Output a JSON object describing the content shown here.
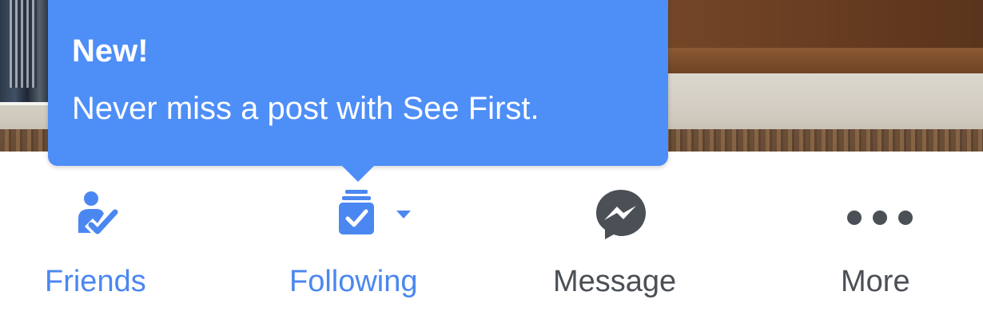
{
  "tooltip": {
    "title": "New!",
    "message": "Never miss a post with See First."
  },
  "actions": [
    {
      "label": "Friends",
      "icon": "friends-check-icon",
      "color": "#4b87f0"
    },
    {
      "label": "Following",
      "icon": "see-first-stack-icon",
      "color": "#4b87f0"
    },
    {
      "label": "Message",
      "icon": "messenger-icon",
      "color": "#4b4f56"
    },
    {
      "label": "More",
      "icon": "more-dots-icon",
      "color": "#4b4f56"
    }
  ],
  "colors": {
    "tooltip_background": "#4e8ef7",
    "accent_blue": "#4b87f0",
    "text_grey": "#4b4f56"
  }
}
